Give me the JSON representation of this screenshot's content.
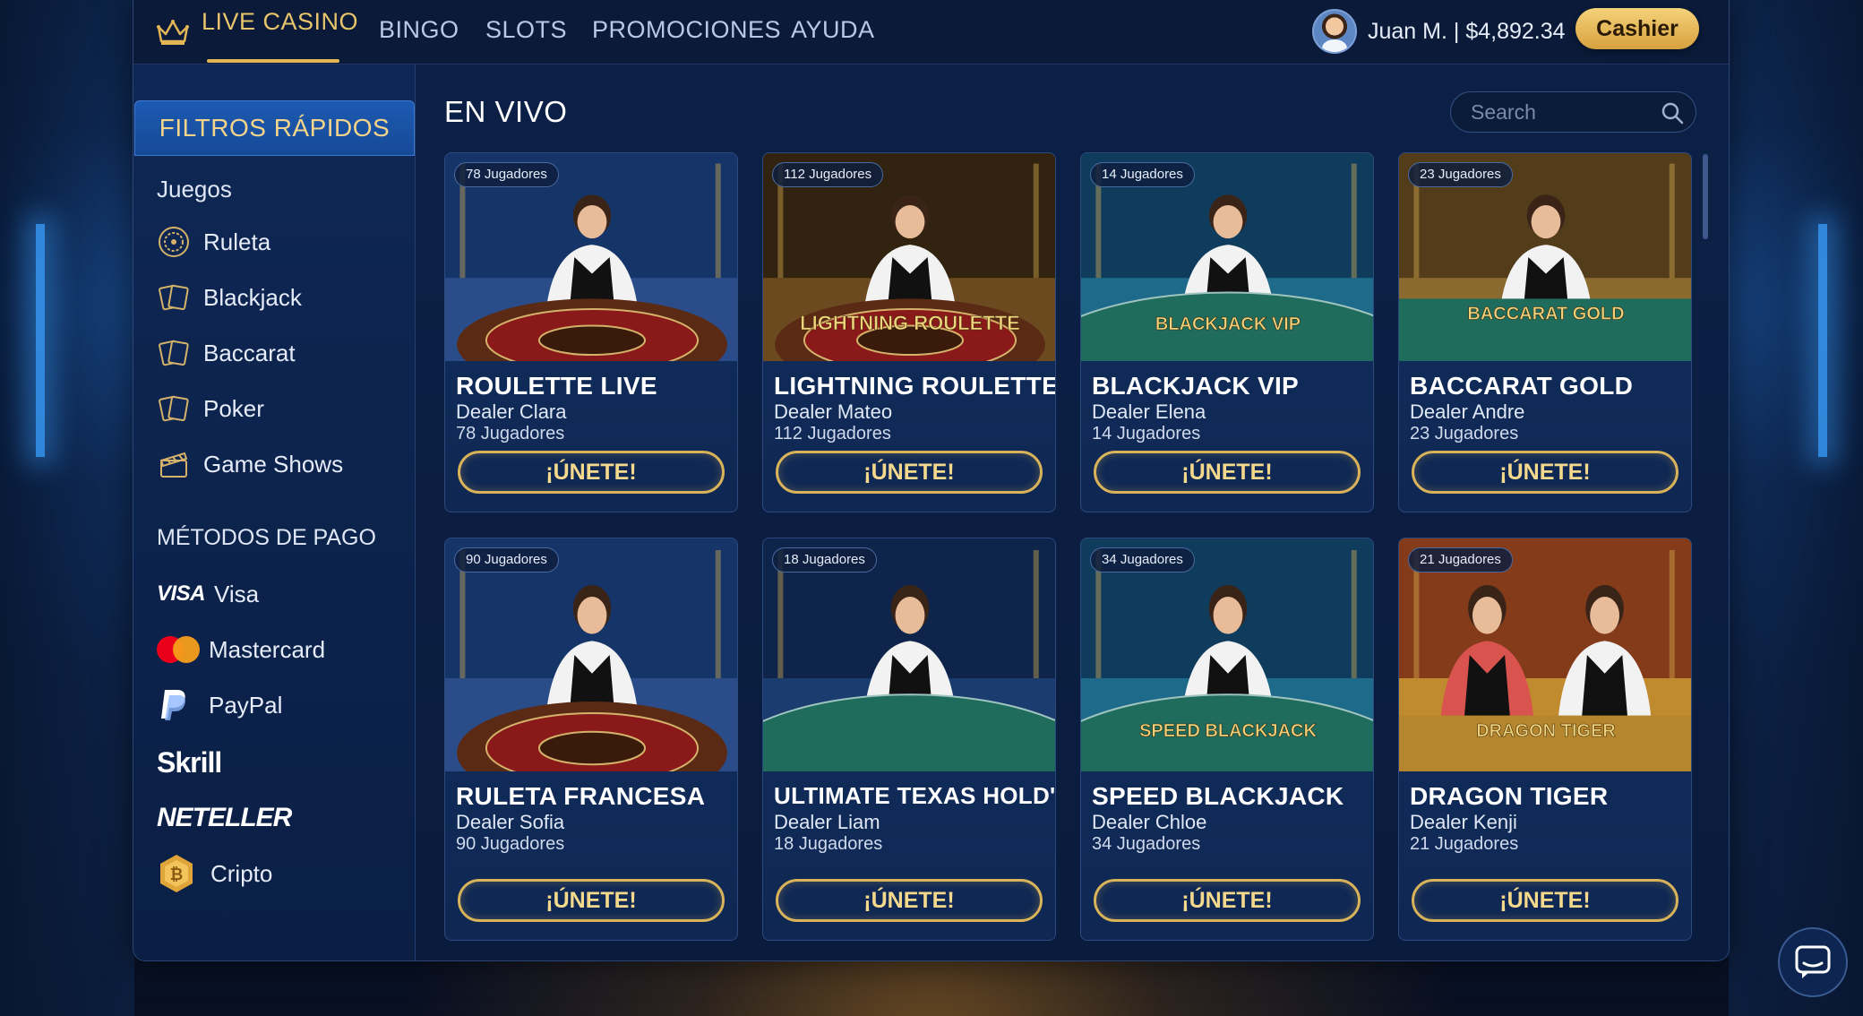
{
  "nav": {
    "brand_label": "LIVE CASINO",
    "items": [
      "BINGO",
      "SLOTS",
      "PROMOCIONES",
      "AYUDA"
    ]
  },
  "user": {
    "label": "Juan M. | $4,892.34"
  },
  "cashier_label": "Cashier",
  "sidebar": {
    "filters_title": "FILTROS RÁPIDOS",
    "games_title": "Juegos",
    "games": [
      {
        "label": "Ruleta",
        "icon": "roulette-icon"
      },
      {
        "label": "Blackjack",
        "icon": "cards-icon"
      },
      {
        "label": "Baccarat",
        "icon": "cards-icon"
      },
      {
        "label": "Poker",
        "icon": "cards-icon"
      },
      {
        "label": "Game Shows",
        "icon": "clapperboard-icon"
      }
    ],
    "payments_title": "MÉTODOS DE PAGO",
    "payments": [
      {
        "label": "Visa",
        "icon": "visa-logo"
      },
      {
        "label": "Mastercard",
        "icon": "mastercard-logo"
      },
      {
        "label": "PayPal",
        "icon": "paypal-logo"
      },
      {
        "label": "Skrill",
        "icon": "skrill-logo"
      },
      {
        "label": "NETELLER",
        "icon": "neteller-logo"
      },
      {
        "label": "Cripto",
        "icon": "crypto-coin-icon"
      }
    ]
  },
  "main": {
    "title": "EN VIVO",
    "search_placeholder": "Search",
    "join_label": "¡ÚNETE!"
  },
  "cards": [
    {
      "title": "ROULETTE LIVE",
      "dealer": "Dealer Clara",
      "players": "78 Jugadores",
      "badge": "78 Jugadores",
      "sign": "",
      "theme": "roulette"
    },
    {
      "title": "LIGHTNING ROULETTE",
      "dealer": "Dealer Mateo",
      "players": "112 Jugadores",
      "badge": "112 Jugadores",
      "sign": "LIGHTNING ROULETTE",
      "theme": "lightning"
    },
    {
      "title": "BLACKJACK VIP",
      "dealer": "Dealer Elena",
      "players": "14 Jugadores",
      "badge": "14 Jugadores",
      "sign": "BLACKJACK VIP",
      "theme": "blackjack"
    },
    {
      "title": "BACCARAT GOLD",
      "dealer": "Dealer Andre",
      "players": "23 Jugadores",
      "badge": "23 Jugadores",
      "sign": "BACCARAT GOLD",
      "theme": "baccarat"
    },
    {
      "title": "RULETA FRANCESA",
      "dealer": "Dealer Sofia",
      "players": "90 Jugadores",
      "badge": "90 Jugadores",
      "sign": "",
      "theme": "roulette"
    },
    {
      "title": "ULTIMATE TEXAS HOLD'EM",
      "dealer": "Dealer Liam",
      "players": "18 Jugadores",
      "badge": "18 Jugadores",
      "sign": "",
      "theme": "holdem"
    },
    {
      "title": "SPEED BLACKJACK",
      "dealer": "Dealer Chloe",
      "players": "34 Jugadores",
      "badge": "34 Jugadores",
      "sign": "SPEED BLACKJACK",
      "theme": "blackjack"
    },
    {
      "title": "DRAGON TIGER",
      "dealer": "Dealer Kenji",
      "players": "21 Jugadores",
      "badge": "21 Jugadores",
      "sign": "DRAGON TIGER",
      "theme": "dragon"
    }
  ],
  "colors": {
    "accent_gold": "#e2b655",
    "panel_blue": "#0c2148",
    "felt_green": "#1f6b5c"
  }
}
